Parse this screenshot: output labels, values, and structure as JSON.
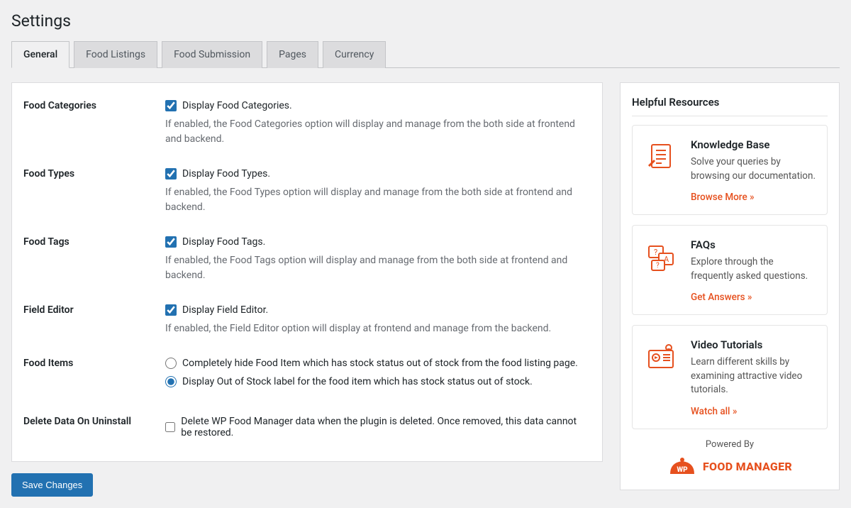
{
  "pageTitle": "Settings",
  "tabs": [
    {
      "label": "General",
      "active": true
    },
    {
      "label": "Food Listings",
      "active": false
    },
    {
      "label": "Food Submission",
      "active": false
    },
    {
      "label": "Pages",
      "active": false
    },
    {
      "label": "Currency",
      "active": false
    }
  ],
  "settings": {
    "foodCategories": {
      "label": "Food Categories",
      "checkLabel": "Display Food Categories.",
      "checked": true,
      "desc": "If enabled, the Food Categories option will display and manage from the both side at frontend and backend."
    },
    "foodTypes": {
      "label": "Food Types",
      "checkLabel": "Display Food Types.",
      "checked": true,
      "desc": "If enabled, the Food Types option will display and manage from the both side at frontend and backend."
    },
    "foodTags": {
      "label": "Food Tags",
      "checkLabel": "Display Food Tags.",
      "checked": true,
      "desc": "If enabled, the Food Tags option will display and manage from the both side at frontend and backend."
    },
    "fieldEditor": {
      "label": "Field Editor",
      "checkLabel": "Display Field Editor.",
      "checked": true,
      "desc": "If enabled, the Field Editor option will display at frontend and manage from the backend."
    },
    "foodItems": {
      "label": "Food Items",
      "options": [
        {
          "label": "Completely hide Food Item which has stock status out of stock from the food listing page.",
          "selected": false
        },
        {
          "label": "Display Out of Stock label for the food item which has stock status out of stock.",
          "selected": true
        }
      ]
    },
    "deleteData": {
      "label": "Delete Data On Uninstall",
      "checkLabel": "Delete WP Food Manager data when the plugin is deleted. Once removed, this data cannot be restored.",
      "checked": false
    }
  },
  "saveButton": "Save Changes",
  "sidebar": {
    "heading": "Helpful Resources",
    "cards": [
      {
        "title": "Knowledge Base",
        "desc": "Solve your queries by browsing our documentation.",
        "link": "Browse More »"
      },
      {
        "title": "FAQs",
        "desc": "Explore through the frequently asked questions.",
        "link": "Get Answers »"
      },
      {
        "title": "Video Tutorials",
        "desc": "Learn different skills by examining attractive video tutorials.",
        "link": "Watch all »"
      }
    ],
    "poweredBy": "Powered By",
    "brand": "FOOD MANAGER",
    "brandBadge": "WP"
  },
  "colors": {
    "accent": "#e6501e",
    "primary": "#2271b1"
  }
}
